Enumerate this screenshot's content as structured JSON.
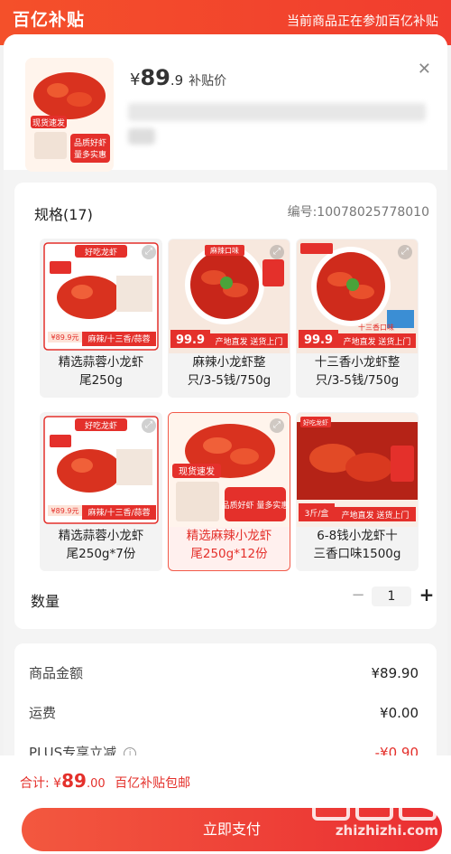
{
  "banner": {
    "logo_text": "百亿补贴",
    "note": "当前商品正在参加百亿补贴"
  },
  "product": {
    "currency": "¥",
    "price_int": "89",
    "price_dec": ".9",
    "price_tag": "补贴价",
    "thumb_text1": "现货速发",
    "thumb_text2": "品质好虾",
    "thumb_text3": "量多实惠"
  },
  "spec": {
    "title": "规格(17)",
    "code": "编号:10078025778010",
    "items": [
      {
        "label_line1": "精选蒜蓉小龙虾",
        "label_line2": "尾250g",
        "badge": "麻辣/十三香/蒜蓉",
        "price_badge": "¥89.9元",
        "banner_top": "好吃龙虾",
        "selected": false
      },
      {
        "label_line1": "麻辣小龙虾整",
        "label_line2": "只/3-5钱/750g",
        "badge": "产地直发 送货上门",
        "price_badge": "99.9",
        "banner_top": "麻辣口味",
        "selected": false
      },
      {
        "label_line1": "十三香小龙虾整",
        "label_line2": "只/3-5钱/750g",
        "badge": "产地直发 送货上门",
        "price_badge": "99.9",
        "banner_top": "十三香口味",
        "selected": false
      },
      {
        "label_line1": "精选蒜蓉小龙虾",
        "label_line2": "尾250g*7份",
        "badge": "麻辣/十三香/蒜蓉",
        "price_badge": "¥89.9元",
        "banner_top": "好吃龙虾",
        "selected": false
      },
      {
        "label_line1": "精选麻辣小龙虾",
        "label_line2": "尾250g*12份",
        "badge": "品质好虾 量多实惠",
        "price_badge": "现货速发",
        "banner_top": "",
        "selected": true
      },
      {
        "label_line1": "6-8钱小龙虾十",
        "label_line2": "三香口味1500g",
        "badge": "产地直发 送货上门",
        "price_badge": "3斤/盒",
        "banner_top": "好吃龙虾",
        "selected": false
      }
    ]
  },
  "quantity": {
    "label": "数量",
    "minus": "−",
    "value": "1",
    "plus": "+"
  },
  "summary": {
    "rows": [
      {
        "label": "商品金额",
        "value": "¥89.90"
      },
      {
        "label": "运费",
        "value": "¥0.00"
      },
      {
        "label": "PLUS专享立减",
        "value": "-¥0.90"
      }
    ]
  },
  "footer": {
    "total_label": "合计:",
    "total_currency": "¥",
    "total_int": "89",
    "total_dec": ".00",
    "total_note": "百亿补贴包邮",
    "pay_label": "立即支付"
  },
  "watermark": {
    "text": "zhizhizhi.com"
  },
  "colors": {
    "accent": "#e4302b",
    "banner": "#f4502a"
  }
}
